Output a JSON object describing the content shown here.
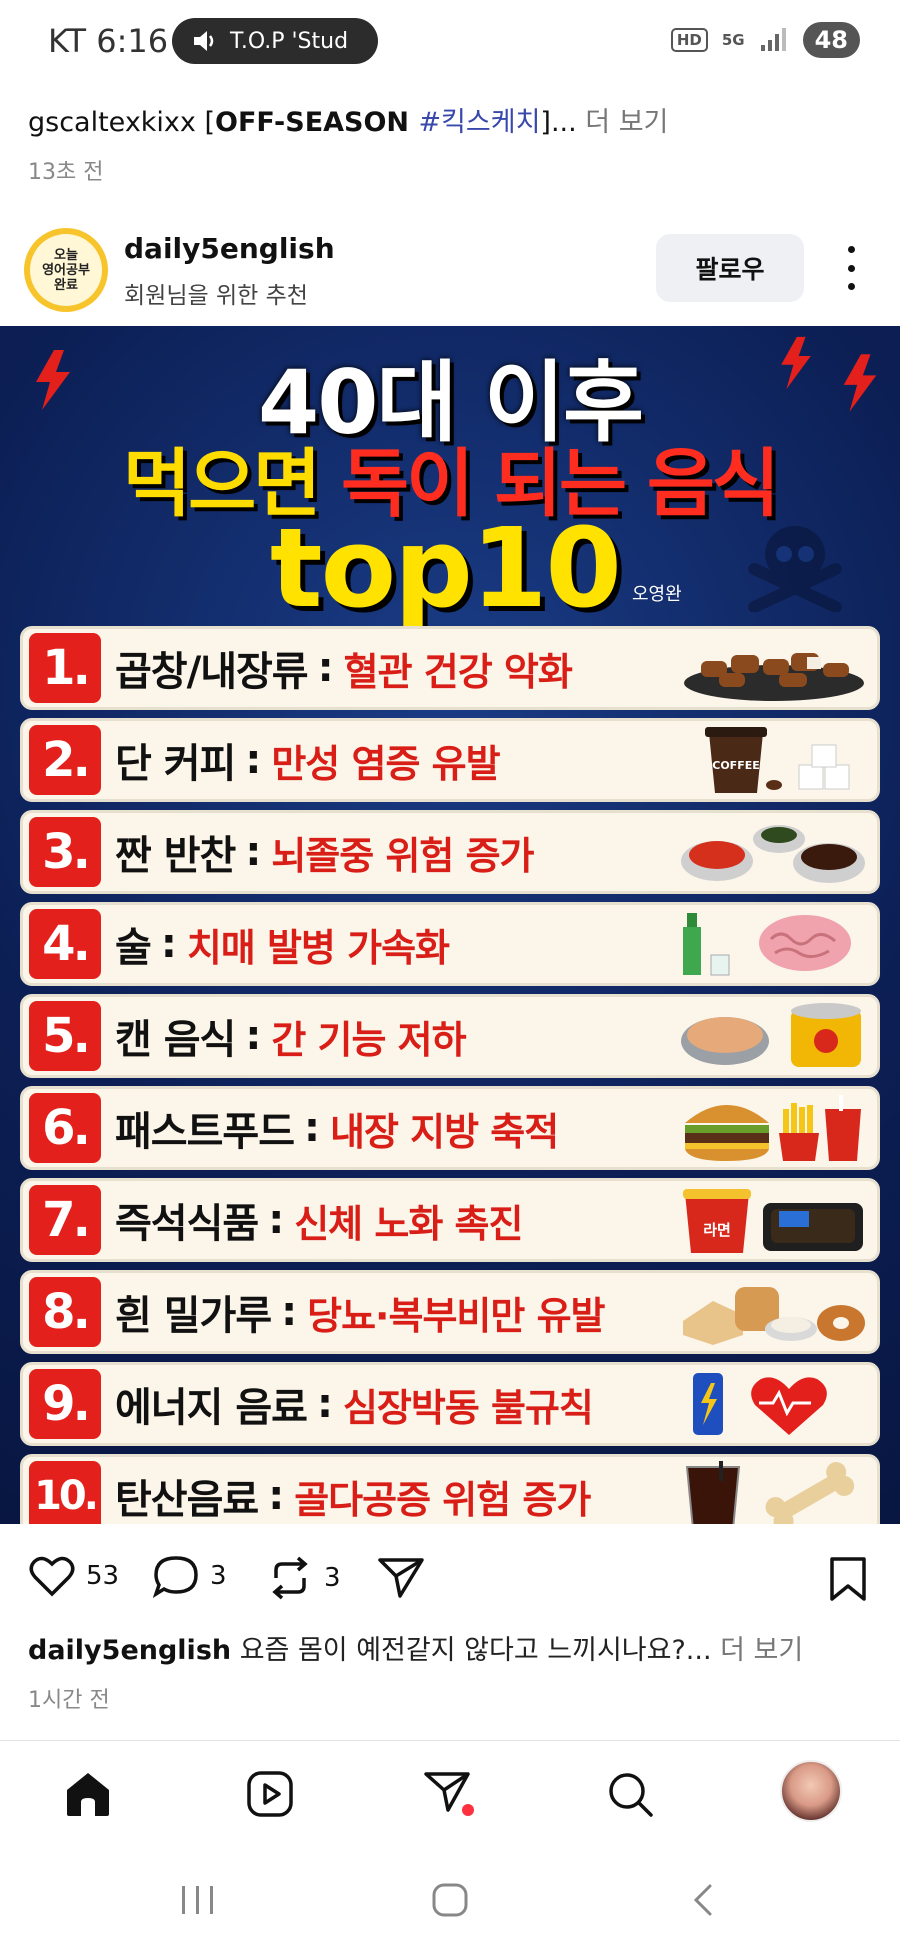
{
  "status_bar": {
    "carrier_time": "KT 6:16",
    "media_label": "T.O.P 'Stud",
    "hd": "HD",
    "network": "5G",
    "battery": "48"
  },
  "previous_post": {
    "user": "gscaltexkixx",
    "bracket_open": " [",
    "title": "OFF-SEASON ",
    "hashtag": "#킥스케치",
    "bracket_close": "]...",
    "more": " 더 보기",
    "time": "13초 전"
  },
  "post": {
    "avatar_text": [
      "오늘",
      "영어공부",
      "완료"
    ],
    "username": "daily5english",
    "subtitle": "회원님을 위한 추천",
    "follow_label": "팔로우",
    "image": {
      "headline1": "40대 이후",
      "headline2_yellow": "먹으면",
      "headline2_red": "독이 되는 음식",
      "headline3": "top10",
      "author": "오영완",
      "items": [
        {
          "num": "1.",
          "food": "곱창/내장류",
          "effect": "혈관 건강 악화"
        },
        {
          "num": "2.",
          "food": "단 커피",
          "effect": "만성 염증 유발"
        },
        {
          "num": "3.",
          "food": "짠 반찬",
          "effect": "뇌졸중 위험 증가"
        },
        {
          "num": "4.",
          "food": "술",
          "effect": "치매 발병 가속화"
        },
        {
          "num": "5.",
          "food": "캔 음식",
          "effect": "간 기능 저하"
        },
        {
          "num": "6.",
          "food": "패스트푸드",
          "effect": "내장 지방 축적"
        },
        {
          "num": "7.",
          "food": "즉석식품",
          "effect": "신체 노화 촉진"
        },
        {
          "num": "8.",
          "food": "흰 밀가루",
          "effect": "당뇨·복부비만 유발"
        },
        {
          "num": "9.",
          "food": "에너지 음료",
          "effect": "심장박동 불규칙"
        },
        {
          "num": "10.",
          "food": "탄산음료",
          "effect": "골다공증 위험 증가"
        }
      ],
      "coffee_label": "COFFEE",
      "ramen_label": "라면"
    },
    "likes": "53",
    "comments": "3",
    "reposts": "3",
    "caption_user": "daily5english",
    "caption_text": " 요즘 몸이 예전같지 않다고 느끼시나요?...",
    "caption_more": " 더 보기",
    "time": "1시간 전"
  }
}
